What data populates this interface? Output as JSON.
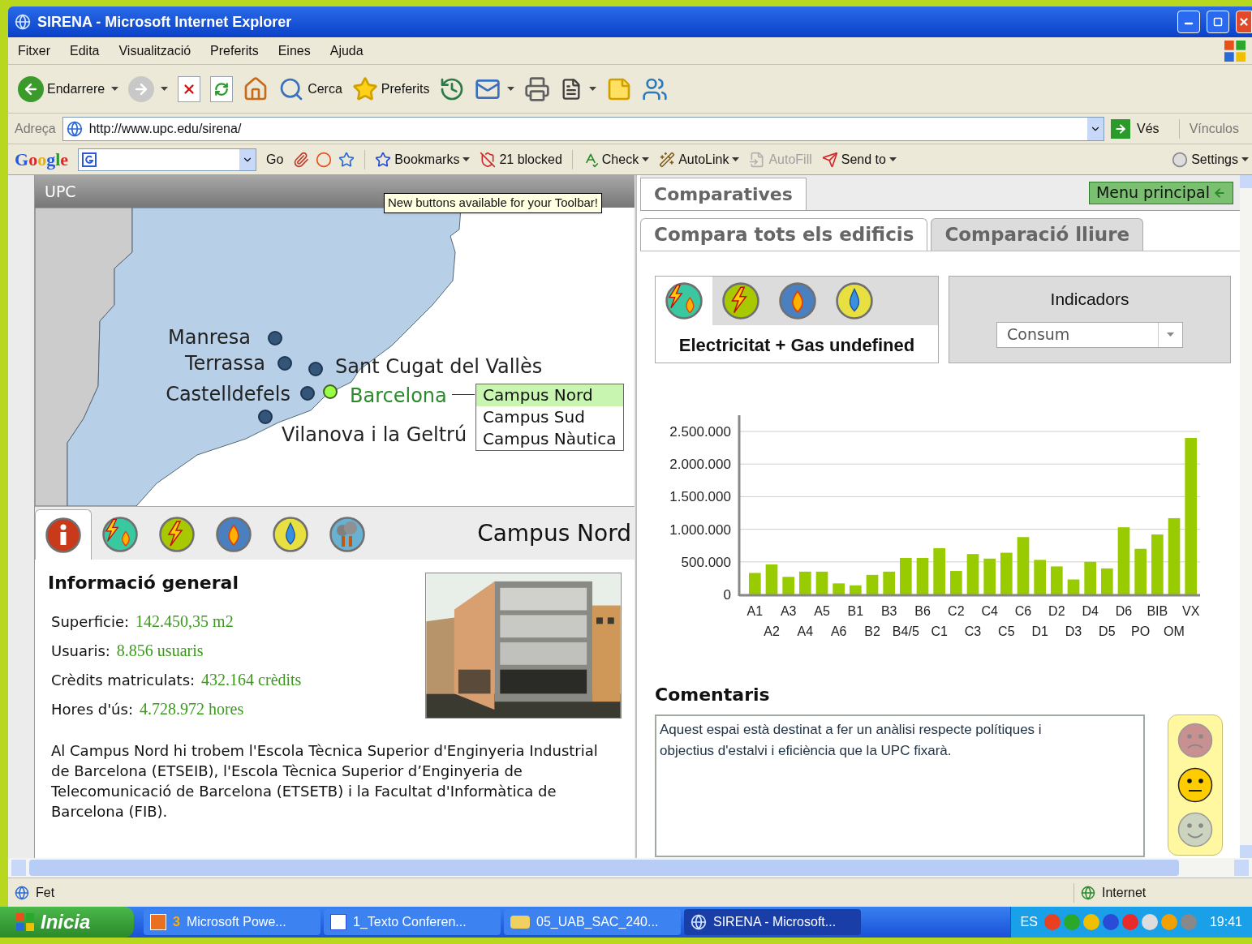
{
  "window": {
    "title": "SIRENA - Microsoft Internet Explorer"
  },
  "menu": [
    "Fitxer",
    "Edita",
    "Visualització",
    "Preferits",
    "Eines",
    "Ajuda"
  ],
  "toolbar": [
    {
      "kind": "back",
      "label": "Endarrere"
    },
    {
      "kind": "forward"
    },
    {
      "kind": "stop"
    },
    {
      "kind": "refresh"
    },
    {
      "kind": "home"
    },
    {
      "kind": "search",
      "label": "Cerca"
    },
    {
      "kind": "favorites",
      "label": "Preferits"
    },
    {
      "kind": "history"
    },
    {
      "kind": "mail"
    },
    {
      "kind": "print"
    },
    {
      "kind": "word"
    },
    {
      "kind": "note"
    },
    {
      "kind": "messenger"
    }
  ],
  "address": {
    "label": "Adreça",
    "url": "http://www.upc.edu/sirena/",
    "go": "Vés",
    "links": "Vínculos"
  },
  "google_bar": {
    "logo": "Google",
    "go": "Go",
    "bookmarks": "Bookmarks",
    "blocked": "21 blocked",
    "check": "Check",
    "autolink": "AutoLink",
    "autofill": "AutoFill",
    "send_to": "Send to",
    "settings": "Settings"
  },
  "tooltip": "New buttons available for your Toolbar!",
  "left": {
    "header": "UPC",
    "cities": [
      {
        "name": "Manresa",
        "selected": false
      },
      {
        "name": "Terrassa",
        "selected": false
      },
      {
        "name": "Sant Cugat del Vallès",
        "selected": false
      },
      {
        "name": "Castelldefels",
        "selected": false
      },
      {
        "name": "Barcelona",
        "selected": true
      },
      {
        "name": "Vilanova i la Geltrú",
        "selected": false
      }
    ],
    "campuses": [
      {
        "name": "Campus Nord",
        "selected": true
      },
      {
        "name": "Campus Sud",
        "selected": false
      },
      {
        "name": "Campus Nàutica",
        "selected": false
      }
    ],
    "icon_tabs": [
      {
        "kind": "info",
        "selected": true
      },
      {
        "kind": "elec_gas",
        "selected": false
      },
      {
        "kind": "elec",
        "selected": false
      },
      {
        "kind": "gas",
        "selected": false
      },
      {
        "kind": "water",
        "selected": false
      },
      {
        "kind": "emissions",
        "selected": false
      }
    ],
    "campus_title": "Campus Nord",
    "info_heading": "Informació general",
    "info_fields": [
      {
        "label": "Superficie:",
        "value": "142.450,35 m2"
      },
      {
        "label": "Usuaris:",
        "value": "8.856 usuaris"
      },
      {
        "label": "Crèdits matriculats:",
        "value": "432.164 crèdits"
      },
      {
        "label": "Hores d'ús:",
        "value": "4.728.972 hores"
      }
    ],
    "description": "Al Campus Nord hi trobem l'Escola Tècnica Superior d'Enginyeria Industrial de Barcelona (ETSEIB), l'Escola Tècnica Superior d’Enginyeria de Telecomunicació de Barcelona (ETSETB) i la Facultat d'Informàtica de Barcelona (FIB)."
  },
  "right": {
    "tab": "Comparatives",
    "menu_button": "Menu principal",
    "subtabs": [
      {
        "label": "Compara tots els edificis",
        "selected": true
      },
      {
        "label": "Comparació lliure",
        "selected": false
      }
    ],
    "energy_tabs": [
      {
        "kind": "elec_gas",
        "selected": true
      },
      {
        "kind": "elec",
        "selected": false
      },
      {
        "kind": "gas",
        "selected": false
      },
      {
        "kind": "water",
        "selected": false
      }
    ],
    "energy_label": "Electricitat + Gas undefined",
    "indicators_title": "Indicadors",
    "indicator_value": "Consum",
    "chart_data": {
      "type": "bar",
      "categories": [
        "A1",
        "A2",
        "A3",
        "A4",
        "A5",
        "A6",
        "B1",
        "B2",
        "B3",
        "B4/5",
        "B6",
        "C1",
        "C2",
        "C3",
        "C4",
        "C5",
        "C6",
        "D1",
        "D2",
        "D3",
        "D4",
        "D5",
        "D6",
        "PO",
        "BIB",
        "OM",
        "VX"
      ],
      "grid": true,
      "series": [
        {
          "color": "#99cc00",
          "values": [
            330000,
            460000,
            270000,
            350000,
            350000,
            170000,
            140000,
            300000,
            350000,
            560000,
            560000,
            710000,
            360000,
            620000,
            550000,
            640000,
            880000,
            530000,
            430000,
            230000,
            500000,
            400000,
            1030000,
            700000,
            920000,
            1170000,
            2400000
          ]
        }
      ],
      "ylim": [
        0,
        2500000
      ],
      "yticks": [
        {
          "value": 0,
          "label": "0"
        },
        {
          "value": 500000,
          "label": "500.000"
        },
        {
          "value": 1000000,
          "label": "1.000.000"
        },
        {
          "value": 1500000,
          "label": "1.500.000"
        },
        {
          "value": 2000000,
          "label": "2.000.000"
        },
        {
          "value": 2500000,
          "label": "2.500.000"
        }
      ]
    },
    "comments_heading": "Comentaris",
    "comment": "Aquest espai està destinat a fer un anàlisi respecte polítiques i objectius d'estalvi i eficiència que la UPC fixarà.",
    "moods": [
      {
        "kind": "sad",
        "selected": false
      },
      {
        "kind": "neutral",
        "selected": true
      },
      {
        "kind": "happy",
        "selected": false
      }
    ]
  },
  "status_bar": {
    "text": "Fet",
    "zone": "Internet"
  },
  "taskbar": {
    "start": "Inicia",
    "tasks": [
      {
        "kind": "powerpoint",
        "count": "3",
        "label": "Microsoft Powe...",
        "selected": false
      },
      {
        "kind": "word",
        "label": "1_Texto Conferen...",
        "selected": false
      },
      {
        "kind": "folder",
        "label": "05_UAB_SAC_240...",
        "selected": false
      },
      {
        "kind": "ie",
        "label": "SIRENA - Microsoft...",
        "selected": true
      }
    ],
    "language": "ES",
    "clock": "19:41"
  }
}
